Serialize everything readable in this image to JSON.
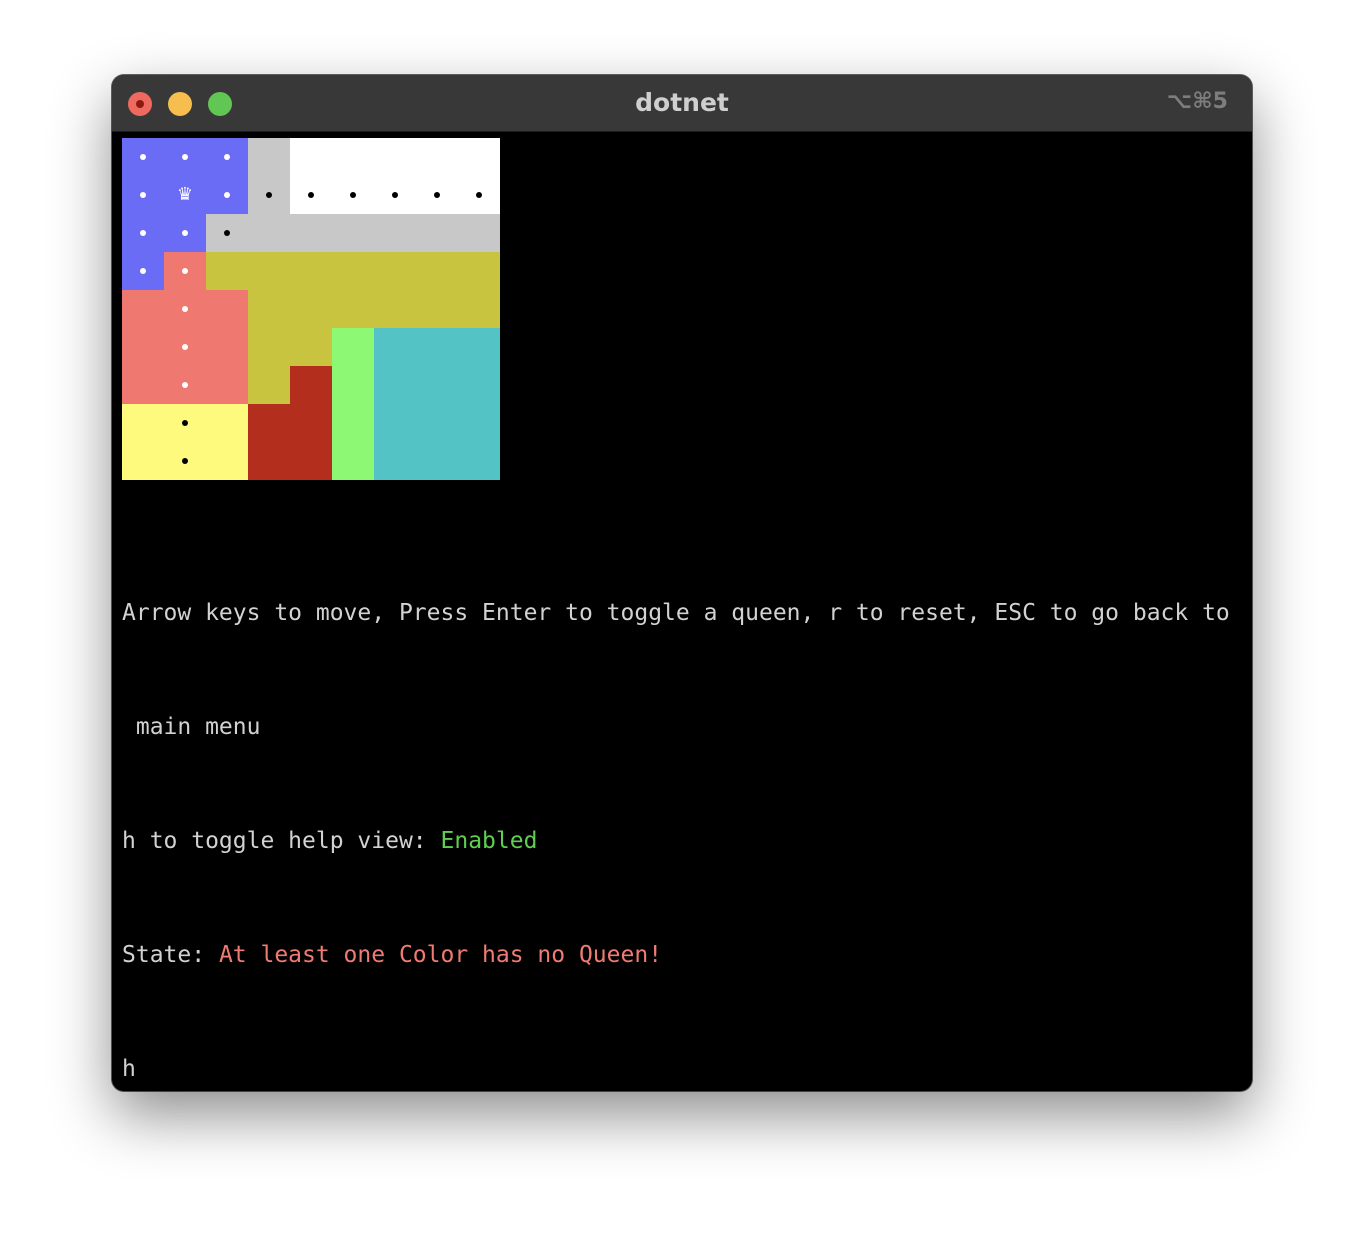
{
  "window": {
    "title": "dotnet",
    "shortcut": "⌥⌘5"
  },
  "colors": {
    "blue": "#6b6cf5",
    "gray": "#c8c8c8",
    "white": "#ffffff",
    "olive": "#c8c440",
    "salmon": "#ef7870",
    "green": "#8cf874",
    "teal": "#54c3c5",
    "darkred": "#b32e1c",
    "yellow": "#fdfa7e"
  },
  "board": {
    "size": 9,
    "regions": [
      [
        "blue",
        "blue",
        "blue",
        "gray",
        "white",
        "white",
        "white",
        "white",
        "white"
      ],
      [
        "blue",
        "blue",
        "blue",
        "gray",
        "white",
        "white",
        "white",
        "white",
        "white"
      ],
      [
        "blue",
        "blue",
        "gray",
        "gray",
        "gray",
        "gray",
        "gray",
        "gray",
        "gray"
      ],
      [
        "blue",
        "salmon",
        "olive",
        "olive",
        "olive",
        "olive",
        "olive",
        "olive",
        "olive"
      ],
      [
        "salmon",
        "salmon",
        "salmon",
        "olive",
        "olive",
        "olive",
        "olive",
        "olive",
        "olive"
      ],
      [
        "salmon",
        "salmon",
        "salmon",
        "olive",
        "olive",
        "green",
        "teal",
        "teal",
        "teal"
      ],
      [
        "salmon",
        "salmon",
        "salmon",
        "olive",
        "darkred",
        "green",
        "teal",
        "teal",
        "teal"
      ],
      [
        "yellow",
        "yellow",
        "yellow",
        "darkred",
        "darkred",
        "green",
        "teal",
        "teal",
        "teal"
      ],
      [
        "yellow",
        "yellow",
        "yellow",
        "darkred",
        "darkred",
        "green",
        "teal",
        "teal",
        "teal"
      ]
    ],
    "marks": [
      [
        ".",
        ".",
        ".",
        "",
        "",
        "",
        "",
        "",
        ""
      ],
      [
        ".",
        "♛",
        ".",
        ".",
        ".",
        ".",
        ".",
        ".",
        "."
      ],
      [
        ".",
        ".",
        ".",
        "",
        "",
        "",
        "",
        "",
        ""
      ],
      [
        ".",
        ".",
        "",
        "",
        "",
        "",
        "",
        "",
        ""
      ],
      [
        "",
        ".",
        "",
        "",
        "",
        "",
        "",
        "",
        ""
      ],
      [
        "",
        ".",
        "",
        "",
        "",
        "",
        "",
        "",
        ""
      ],
      [
        "",
        ".",
        "",
        "",
        "",
        "",
        "",
        "",
        ""
      ],
      [
        "",
        ".",
        "",
        "",
        "",
        "",
        "",
        "",
        ""
      ],
      [
        "",
        ".",
        "",
        "",
        "",
        "",
        "",
        "",
        ""
      ]
    ],
    "mark_colors": [
      [
        "#ffffff",
        "#ffffff",
        "#ffffff",
        "",
        "",
        "",
        "",
        "",
        ""
      ],
      [
        "#ffffff",
        "#ffffff",
        "#ffffff",
        "#000000",
        "#000000",
        "#000000",
        "#000000",
        "#000000",
        "#000000"
      ],
      [
        "#ffffff",
        "#ffffff",
        "#000000",
        "",
        "",
        "",
        "",
        "",
        ""
      ],
      [
        "#ffffff",
        "#ffffff",
        "",
        "",
        "",
        "",
        "",
        "",
        ""
      ],
      [
        "",
        "#ffffff",
        "",
        "",
        "",
        "",
        "",
        "",
        ""
      ],
      [
        "",
        "#ffffff",
        "",
        "",
        "",
        "",
        "",
        "",
        ""
      ],
      [
        "",
        "#ffffff",
        "",
        "",
        "",
        "",
        "",
        "",
        ""
      ],
      [
        "",
        "#000000",
        "",
        "",
        "",
        "",
        "",
        "",
        ""
      ],
      [
        "",
        "#000000",
        "",
        "",
        "",
        "",
        "",
        "",
        ""
      ]
    ]
  },
  "help": {
    "line1": "Arrow keys to move, Press Enter to toggle a queen, r to reset, ESC to go back to",
    "line2": " main menu",
    "help_prefix": "h to toggle help view: ",
    "help_status": "Enabled",
    "state_prefix": "State: ",
    "state_message": "At least one Color has no Queen!",
    "input_echo": "h"
  }
}
